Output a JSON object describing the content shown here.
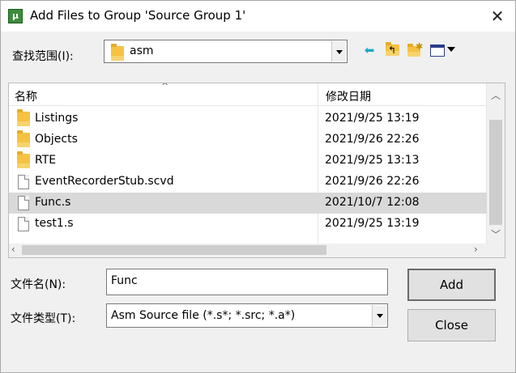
{
  "window": {
    "title": "Add Files to Group 'Source Group 1'",
    "app_icon": "uvision-icon",
    "close_glyph": "✕"
  },
  "look_in": {
    "label": "查找范围(I):",
    "value": "asm",
    "toolbar_icons": [
      "back-icon",
      "up-folder-icon",
      "new-folder-icon",
      "view-menu-icon"
    ]
  },
  "list": {
    "columns": [
      "名称",
      "修改日期"
    ],
    "rows": [
      {
        "name": "Listings",
        "date": "2021/9/25 13:19",
        "type": "folder",
        "selected": false
      },
      {
        "name": "Objects",
        "date": "2021/9/26 22:26",
        "type": "folder",
        "selected": false
      },
      {
        "name": "RTE",
        "date": "2021/9/25 13:13",
        "type": "folder",
        "selected": false
      },
      {
        "name": "EventRecorderStub.scvd",
        "date": "2021/9/26 22:26",
        "type": "file",
        "selected": false
      },
      {
        "name": "Func.s",
        "date": "2021/10/7 12:08",
        "type": "file",
        "selected": true
      },
      {
        "name": "test1.s",
        "date": "2021/9/25 13:19",
        "type": "file",
        "selected": false
      }
    ]
  },
  "file_name": {
    "label": "文件名(N):",
    "value": "Func"
  },
  "file_type": {
    "label": "文件类型(T):",
    "value": "Asm Source file (*.s*; *.src; *.a*)"
  },
  "buttons": {
    "add": "Add",
    "close": "Close"
  }
}
